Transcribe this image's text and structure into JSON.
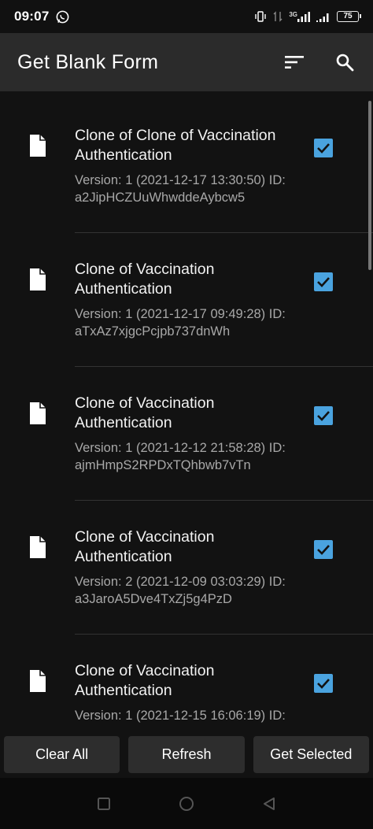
{
  "status_bar": {
    "time": "09:07",
    "network": "3G",
    "battery": "75"
  },
  "app_bar": {
    "title": "Get Blank Form",
    "icons": [
      "sort-icon",
      "search-icon"
    ]
  },
  "forms": [
    {
      "title": "Clone of Clone of Vaccination Authentication",
      "meta": "Version: 1 (2021-12-17 13:30:50) ID: a2JipHCZUuWhwddeAybcw5",
      "checked": true
    },
    {
      "title": "Clone of Vaccination Authentication",
      "meta": "Version: 1 (2021-12-17 09:49:28) ID: aTxAz7xjgcPcjpb737dnWh",
      "checked": true
    },
    {
      "title": "Clone of Vaccination Authentication",
      "meta": "Version: 1 (2021-12-12 21:58:28) ID: ajmHmpS2RPDxTQhbwb7vTn",
      "checked": true
    },
    {
      "title": "Clone of Vaccination Authentication",
      "meta": "Version: 2 (2021-12-09 03:03:29) ID: a3JaroA5Dve4TxZj5g4PzD",
      "checked": true
    },
    {
      "title": "Clone of Vaccination Authentication",
      "meta": "Version: 1 (2021-12-15 16:06:19) ID:",
      "checked": true
    }
  ],
  "actions": {
    "clear_all": "Clear All",
    "refresh": "Refresh",
    "get_selected": "Get Selected"
  },
  "colors": {
    "accent": "#4aa3df",
    "app_bar": "#2b2b2b",
    "background": "#121212"
  }
}
